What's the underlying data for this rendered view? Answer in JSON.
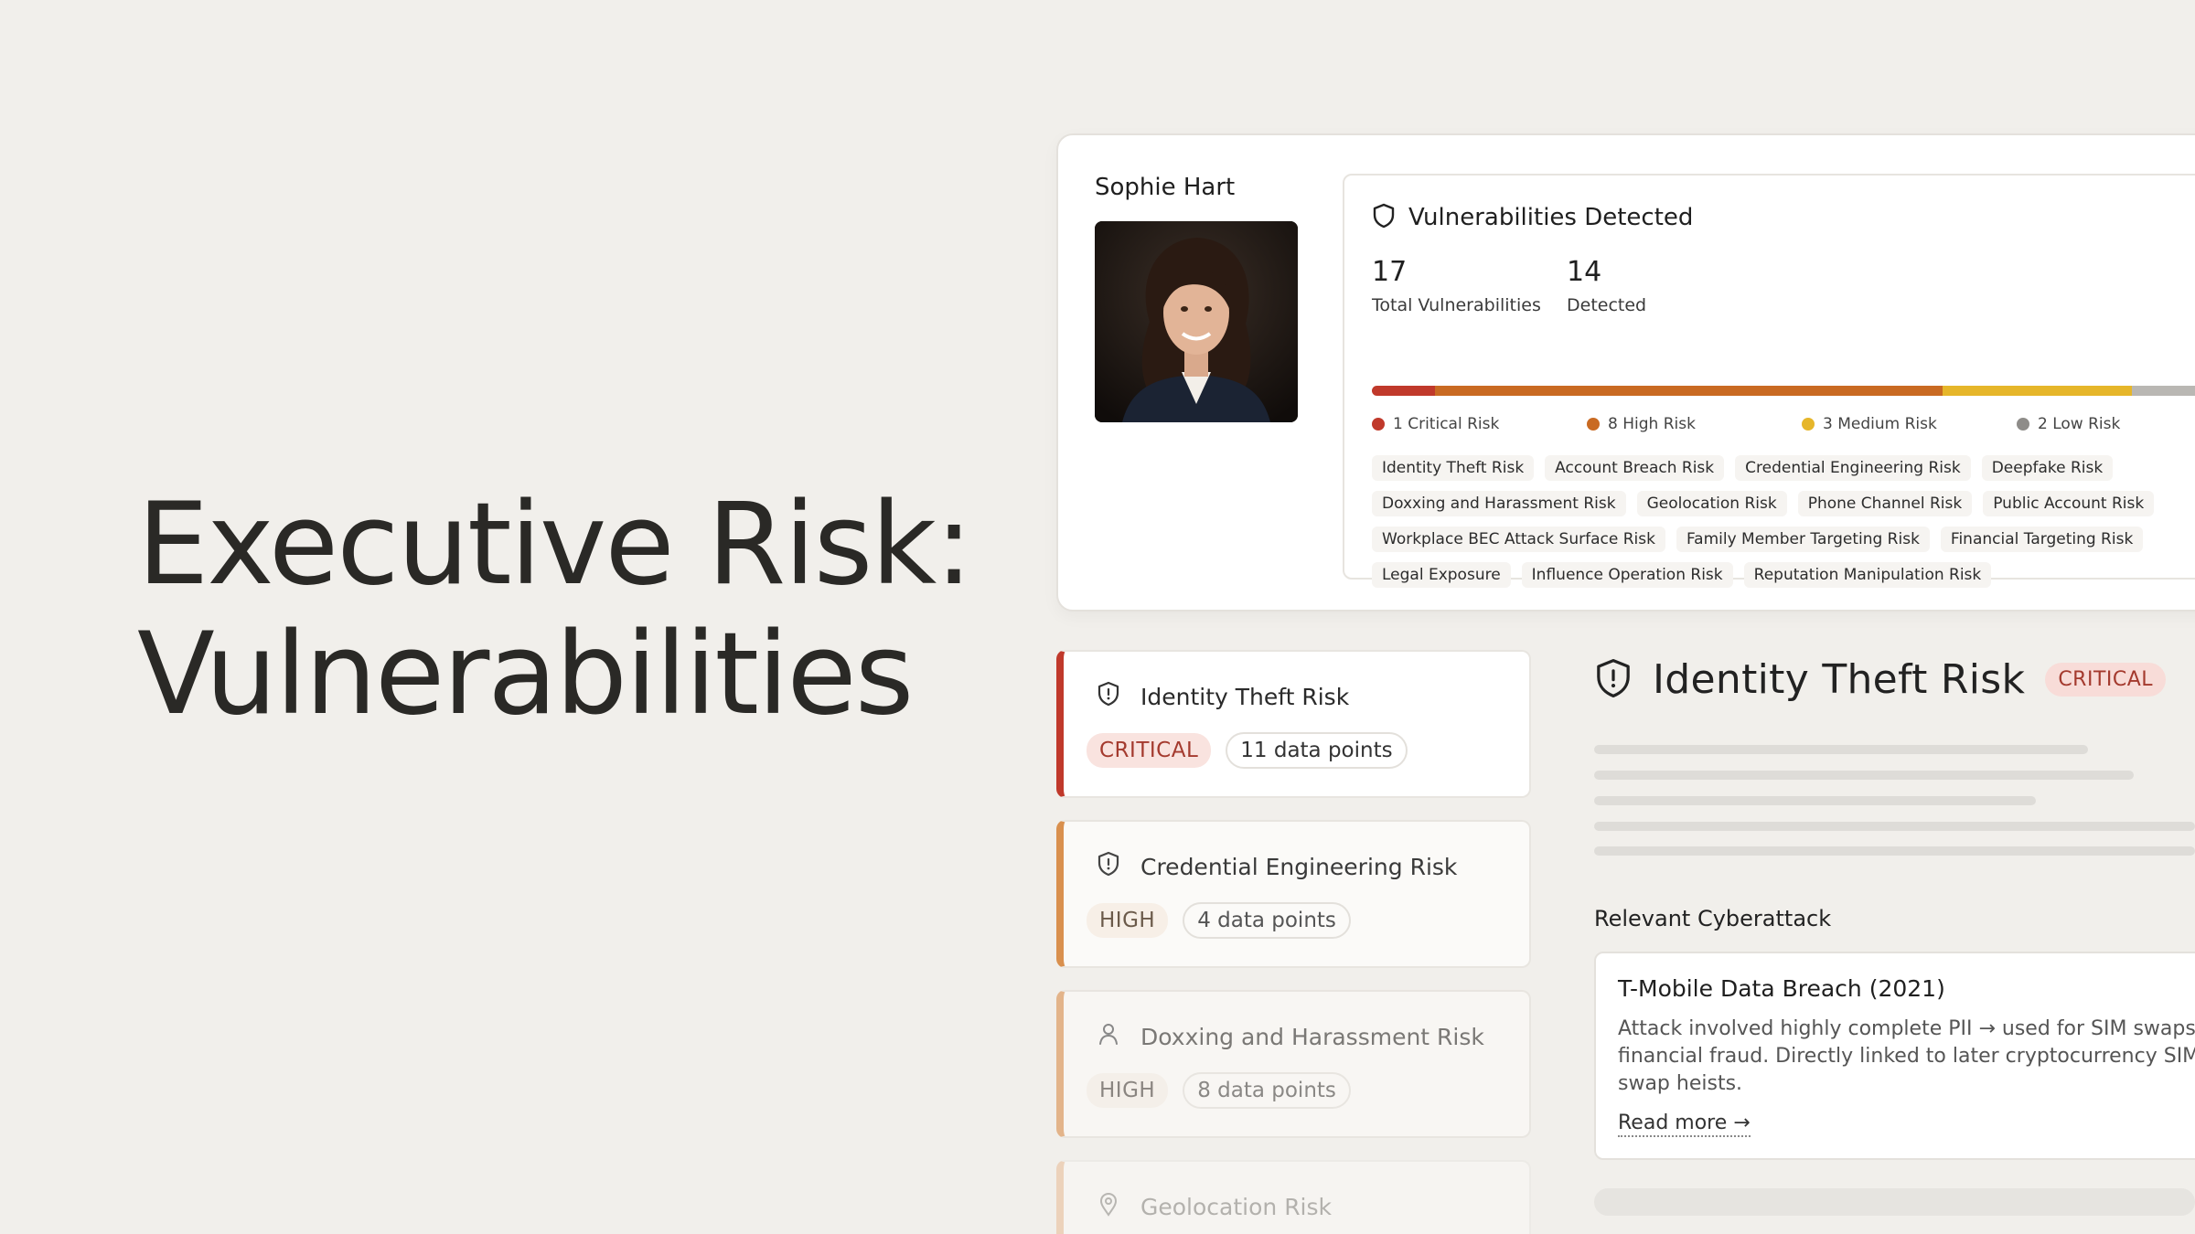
{
  "hero": {
    "line1": "Executive Risk:",
    "line2": "Vulnerabilities"
  },
  "profile": {
    "name": "Sophie Hart",
    "panel_title": "Vulnerabilities Detected",
    "total_value": "17",
    "total_label": "Total Vulnerabilities",
    "detected_value": "14",
    "detected_label": "Detected",
    "risk_bar": [
      {
        "level": "critical",
        "count": 1,
        "color": "#c0392b"
      },
      {
        "level": "high",
        "count": 8,
        "color": "#c96a22"
      },
      {
        "level": "medium",
        "count": 3,
        "color": "#e6b62a"
      },
      {
        "level": "low",
        "count": 2,
        "color": "#b9b7b3"
      }
    ],
    "legend": [
      {
        "label": "1 Critical  Risk",
        "color": "#c0392b"
      },
      {
        "label": "8 High Risk",
        "color": "#c96a22"
      },
      {
        "label": "3 Medium Risk",
        "color": "#e6b62a"
      },
      {
        "label": "2 Low Risk",
        "color": "#8e8c89"
      }
    ],
    "tags": [
      "Identity Theft Risk",
      "Account Breach Risk",
      "Credential Engineering Risk",
      "Deepfake Risk",
      "Doxxing and Harassment Risk",
      "Geolocation Risk",
      "Phone Channel Risk",
      "Public Account Risk",
      "Workplace BEC Attack Surface Risk",
      "Family Member Targeting Risk",
      "Financial Targeting Risk",
      "Legal Exposure",
      "Influence Operation Risk",
      "Reputation Manipulation Risk"
    ]
  },
  "risk_list": [
    {
      "title": "Identity Theft Risk",
      "severity": "CRITICAL",
      "data_points": "11 data points",
      "icon": "shield-alert-icon",
      "accent": "#c0392b"
    },
    {
      "title": "Credential Engineering Risk",
      "severity": "HIGH",
      "data_points": "4 data points",
      "icon": "shield-alert-icon",
      "accent": "#d9904e"
    },
    {
      "title": "Doxxing and Harassment Risk",
      "severity": "HIGH",
      "data_points": "8 data points",
      "icon": "person-icon",
      "accent": "#e3b48a"
    },
    {
      "title": "Geolocation Risk",
      "icon": "location-pin-icon",
      "accent": "#ecd2bb"
    }
  ],
  "detail": {
    "title": "Identity Theft Risk",
    "severity": "CRITICAL",
    "section_label": "Relevant Cyberattack",
    "attack_title": "T-Mobile Data Breach (2021)",
    "attack_desc": "Attack involved highly complete PII → used for SIM swaps, financial fraud. Directly linked to later cryptocurrency SIM-swap heists.",
    "read_more": "Read more →"
  }
}
